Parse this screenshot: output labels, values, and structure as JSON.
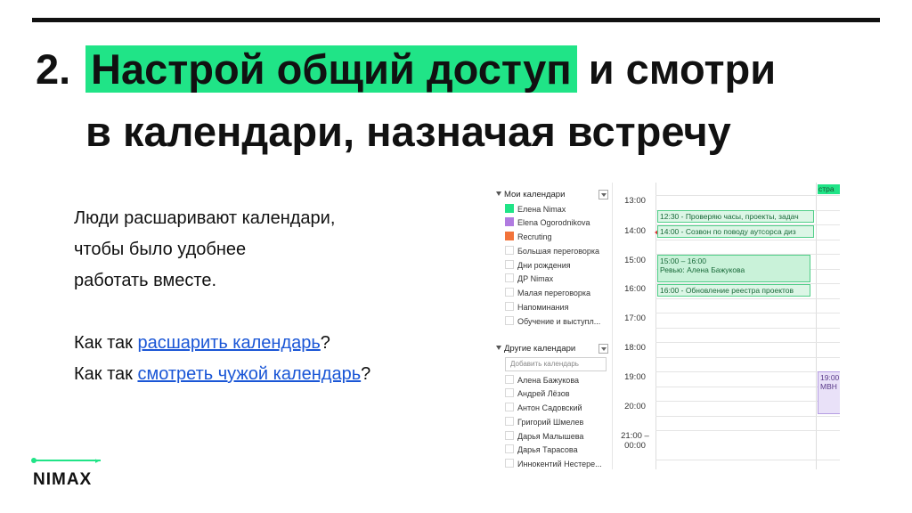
{
  "title": {
    "number": "2.",
    "highlight": "Настрой общий доступ",
    "rest": "и смотри",
    "line2": "в календари, назначая встречу"
  },
  "body": {
    "line1": "Люди расшаривают календари,",
    "line2": "чтобы было удобнее",
    "line3": "работать вместе.",
    "q1_prefix": "Как так ",
    "q1_link": "расшарить календарь",
    "q1_suffix": "?",
    "q2_prefix": "Как так ",
    "q2_link": "смотреть чужой календарь",
    "q2_suffix": "?"
  },
  "logo": {
    "text": "NIMAX"
  },
  "colors": {
    "accent": "#20e487",
    "link": "#1a56d6"
  },
  "calendar": {
    "my_calendars": {
      "label": "Мои календари",
      "items": [
        {
          "label": "Елена Nimax",
          "color": "#20e487"
        },
        {
          "label": "Elena Ogorodnikova",
          "color": "#b07be0"
        },
        {
          "label": "Recruting",
          "color": "#f2733a"
        },
        {
          "label": "Большая переговорка",
          "color": ""
        },
        {
          "label": "Дни рождения",
          "color": ""
        },
        {
          "label": "ДР Nimax",
          "color": ""
        },
        {
          "label": "Малая переговорка",
          "color": ""
        },
        {
          "label": "Напоминания",
          "color": ""
        },
        {
          "label": "Обучение и выступл...",
          "color": ""
        }
      ]
    },
    "other_calendars": {
      "label": "Другие календари",
      "add_placeholder": "Добавить календарь",
      "items": [
        {
          "label": "Алена Бажукова"
        },
        {
          "label": "Андрей Лёзов"
        },
        {
          "label": "Антон Садовский"
        },
        {
          "label": "Григорий Шмелев"
        },
        {
          "label": "Дарья Малышева"
        },
        {
          "label": "Дарья Тарасова"
        },
        {
          "label": "Иннокентий Нестере..."
        }
      ]
    },
    "times": [
      "13:00",
      "14:00",
      "15:00",
      "16:00",
      "17:00",
      "18:00",
      "19:00",
      "20:00",
      "21:00 –",
      "00:00"
    ],
    "events": {
      "e1": "12:30 - Проверяю часы, проекты, задач",
      "e2": "14:00 - Созвон по поводу аутсорса диз",
      "e3_time": "15:00 – 16:00",
      "e3_title": "Ревью: Алена Бажукова",
      "e4": "16:00 - Обновление реестра проектов",
      "top_right": "стра",
      "p1": "19:00",
      "p2": "МВН"
    }
  }
}
